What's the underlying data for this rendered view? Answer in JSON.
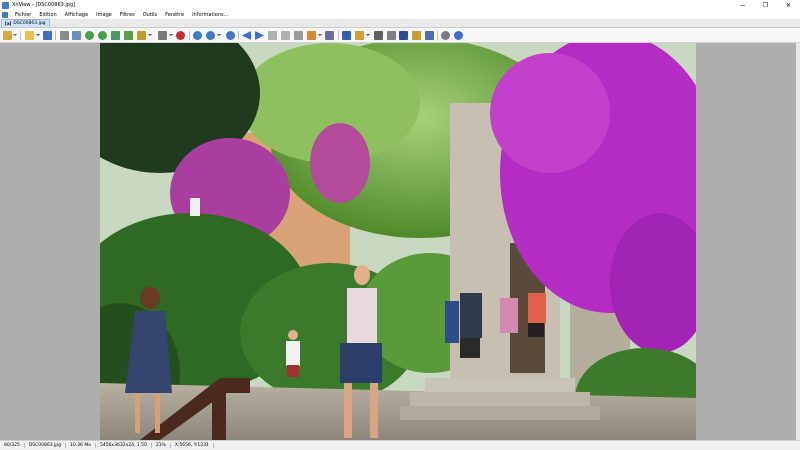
{
  "window": {
    "title": "XnView - [DSC00863.jpg]",
    "minimize_glyph": "—",
    "maximize_glyph": "❐",
    "close_glyph": "✕"
  },
  "menu": {
    "items": [
      "Fichier",
      "Edition",
      "Affichage",
      "Image",
      "Filtres",
      "Outils",
      "Fenêtre",
      "Informations..."
    ]
  },
  "tab": {
    "icon_text": "[a]",
    "label": "DSC00863.jpg"
  },
  "toolbar_icons": [
    "browser-icon",
    "open-folder-icon",
    "save-icon",
    "print-icon",
    "scan-icon",
    "rotate-left-icon",
    "rotate-right-icon",
    "flip-icon",
    "resize-icon",
    "crop-icon",
    "adjust-icon",
    "fullscreen-icon",
    "delete-icon",
    "zoom-in-icon",
    "zoom-options-icon",
    "zoom-out-icon",
    "previous-icon",
    "next-icon",
    "first-icon",
    "last-icon",
    "slideshow-icon",
    "compare-icon",
    "info-icon",
    "settings-icon",
    "convert-icon",
    "find-icon",
    "printer-icon",
    "film-icon",
    "screenshot-icon",
    "capture-icon",
    "options-icon",
    "help-icon"
  ],
  "status": {
    "position": "80/325",
    "filename": "DSC00863.jpg",
    "filesize": "10.36 Mo",
    "dimensions": "5456x3632x24, 1.50",
    "zoom": "21%",
    "coordinates": "X:5656, Y:1231"
  },
  "colors": {
    "viewer_background": "#aeaeae",
    "tab_active": "#cfe4fb",
    "bougainvillea": "#b52cc4"
  }
}
